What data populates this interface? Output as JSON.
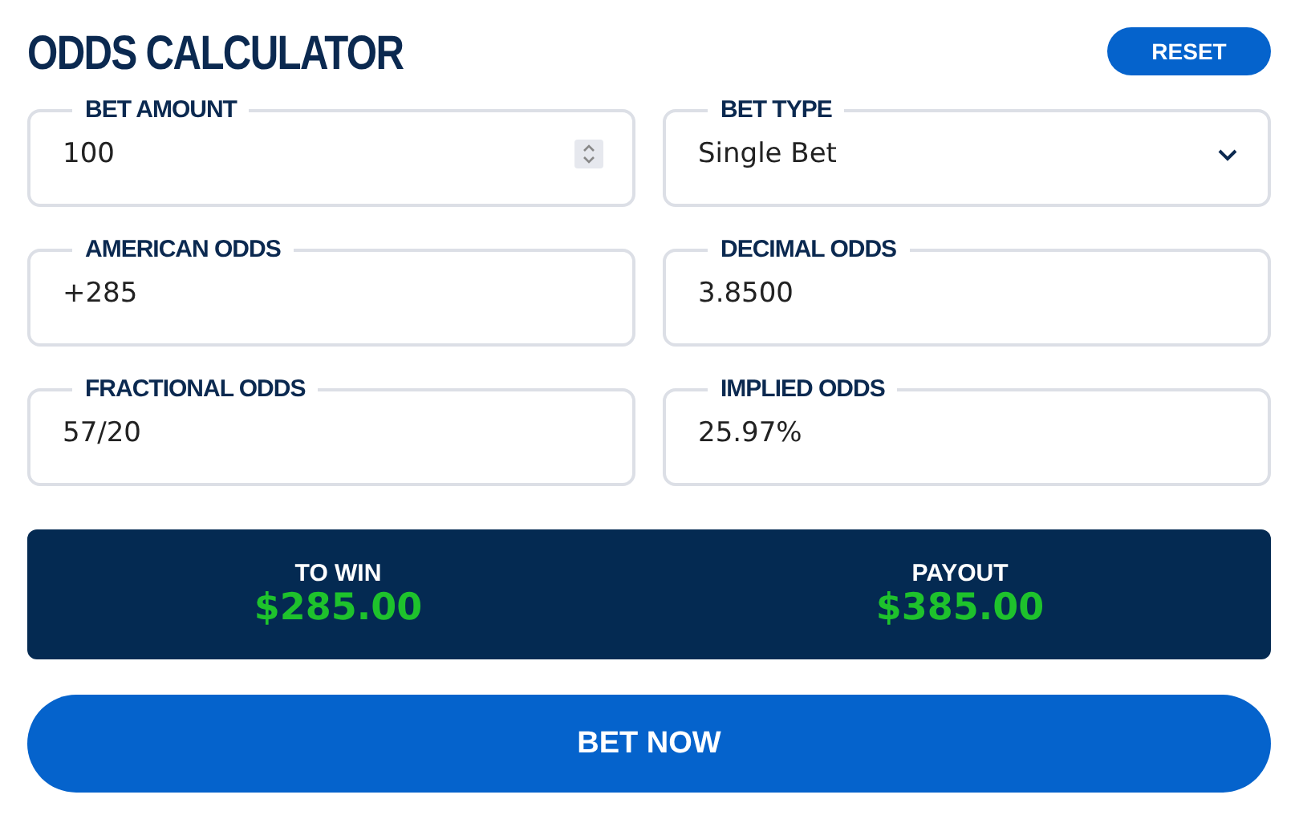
{
  "title": "ODDS CALCULATOR",
  "reset_button": "RESET",
  "fields": [
    {
      "kind": "number",
      "label": "BET AMOUNT",
      "value": "100"
    },
    {
      "kind": "select",
      "label": "BET TYPE",
      "value": "Single Bet"
    },
    {
      "kind": "text",
      "label": "AMERICAN ODDS",
      "value": "+285"
    },
    {
      "kind": "text",
      "label": "DECIMAL ODDS",
      "value": "3.8500"
    },
    {
      "kind": "text",
      "label": "FRACTIONAL ODDS",
      "value": "57/20"
    },
    {
      "kind": "text",
      "label": "IMPLIED ODDS",
      "value": "25.97%"
    }
  ],
  "summary": [
    {
      "label": "TO WIN",
      "value": "$285.00"
    },
    {
      "label": "PAYOUT",
      "value": "$385.00"
    }
  ],
  "bet_button": "BET NOW"
}
